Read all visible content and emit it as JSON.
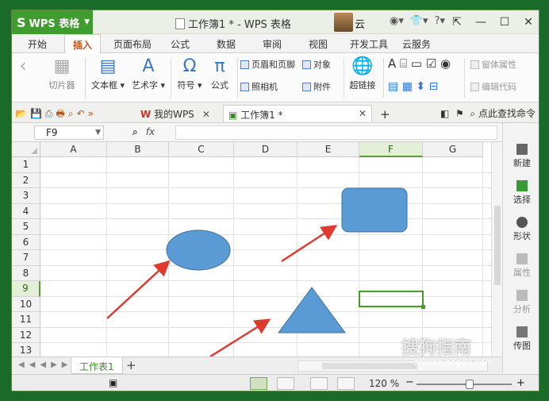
{
  "app": {
    "brand": "WPS 表格",
    "window_title": "工作簿1 * - WPS 表格",
    "user": "云"
  },
  "menu": {
    "tabs": [
      "开始",
      "插入",
      "页面布局",
      "公式",
      "数据",
      "审阅",
      "视图",
      "开发工具",
      "云服务"
    ],
    "active": "插入"
  },
  "ribbon": {
    "clipart": "切片器",
    "textbox": "文本框",
    "wordart": "艺术字",
    "symbol": "符号",
    "formula": "公式",
    "header_footer": "页眉和页脚",
    "object": "对象",
    "camera": "照相机",
    "attachment": "附件",
    "hyperlink": "超链接",
    "form_props": "窗体属性",
    "edit_code": "编辑代码"
  },
  "doc_tabs": {
    "mywps": "我的WPS",
    "workbook": "工作簿1 *",
    "search": "点此查找命令"
  },
  "formula_bar": {
    "cell_ref": "F9",
    "fx_label": "fx"
  },
  "grid": {
    "columns": [
      "A",
      "B",
      "C",
      "D",
      "E",
      "F",
      "G"
    ],
    "rows": [
      "1",
      "2",
      "3",
      "4",
      "5",
      "6",
      "7",
      "8",
      "9",
      "10",
      "11",
      "12",
      "13"
    ],
    "selected_column": "F",
    "selected_row": "9"
  },
  "right_panel": {
    "items": [
      "新建",
      "选择",
      "形状",
      "属性",
      "分析",
      "传图"
    ]
  },
  "sheet": {
    "tab": "工作表1"
  },
  "status": {
    "zoom": "120 %"
  },
  "colors": {
    "shape_fill": "#5b9bd5",
    "shape_stroke": "#41719c",
    "arrow": "#e03a30",
    "accent": "#3f9d2f"
  },
  "watermark": {
    "brand": "搜狗指南",
    "url": "zhinan.sogou.com"
  }
}
